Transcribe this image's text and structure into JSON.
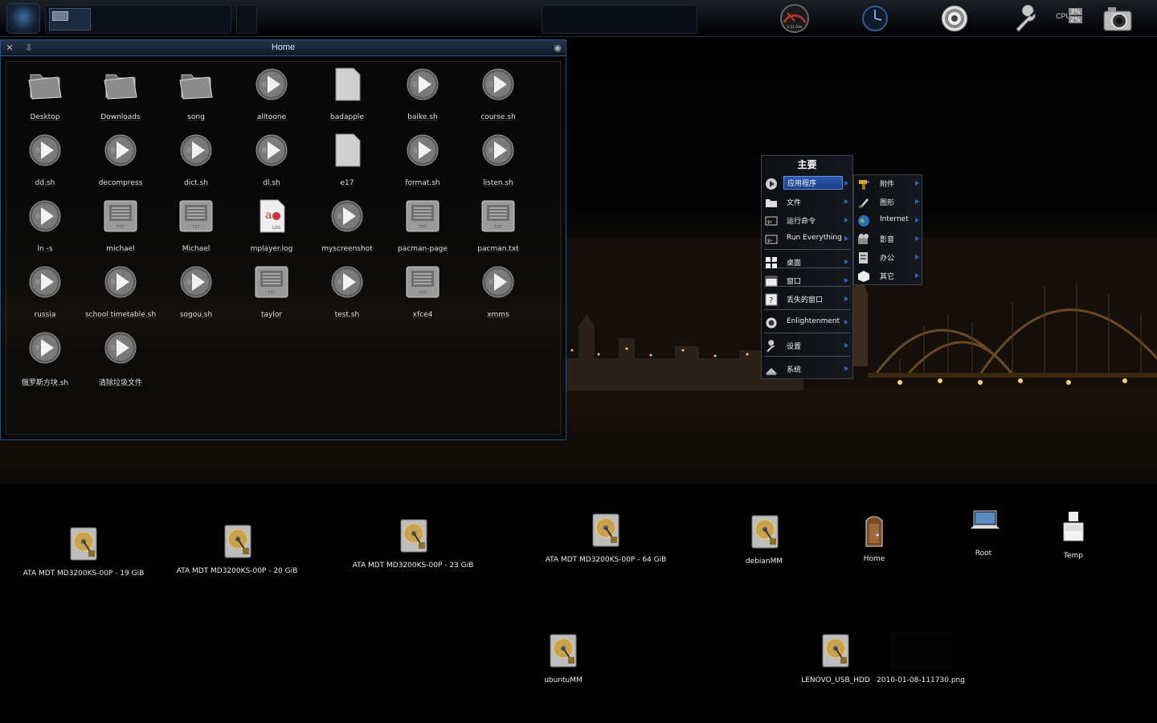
{
  "file_manager": {
    "title": "Home",
    "items": [
      {
        "label": "Desktop",
        "type": "folder"
      },
      {
        "label": "Downloads",
        "type": "folder"
      },
      {
        "label": "song",
        "type": "folder"
      },
      {
        "label": "alltoone",
        "type": "script"
      },
      {
        "label": "badapple",
        "type": "file"
      },
      {
        "label": "baike.sh",
        "type": "script"
      },
      {
        "label": "course.sh",
        "type": "script"
      },
      {
        "label": "dd.sh",
        "type": "script"
      },
      {
        "label": "decompress",
        "type": "script"
      },
      {
        "label": "dict.sh",
        "type": "script"
      },
      {
        "label": "dl.sh",
        "type": "script"
      },
      {
        "label": "e17",
        "type": "file"
      },
      {
        "label": "format.sh",
        "type": "script"
      },
      {
        "label": "listen.sh",
        "type": "script"
      },
      {
        "label": "ln -s",
        "type": "script"
      },
      {
        "label": "michael",
        "type": "text"
      },
      {
        "label": "Michael",
        "type": "text"
      },
      {
        "label": "mplayer.log",
        "type": "log"
      },
      {
        "label": "myscreenshot",
        "type": "script"
      },
      {
        "label": "pacman-page",
        "type": "text"
      },
      {
        "label": "pacman.txt",
        "type": "text"
      },
      {
        "label": "russia",
        "type": "script"
      },
      {
        "label": "school timetable.sh",
        "type": "script"
      },
      {
        "label": "sogou.sh",
        "type": "script"
      },
      {
        "label": "taylor",
        "type": "text"
      },
      {
        "label": "test.sh",
        "type": "script"
      },
      {
        "label": "xfce4",
        "type": "text"
      },
      {
        "label": "xmms",
        "type": "script"
      },
      {
        "label": "俄罗斯方块.sh",
        "type": "script"
      },
      {
        "label": "清除垃圾文件",
        "type": "script"
      }
    ]
  },
  "main_menu": {
    "title": "主要",
    "items": [
      {
        "label": "应用程序",
        "icon": "play-icon"
      },
      {
        "label": "文件",
        "icon": "folder-icon"
      },
      {
        "label": "运行命令",
        "icon": "terminal-icon"
      },
      {
        "label": "Run Everything",
        "icon": "terminal-icon"
      },
      {
        "label": "桌面",
        "icon": "desktop-grid-icon"
      },
      {
        "label": "窗口",
        "icon": "window-icon"
      },
      {
        "label": "丢失的窗口",
        "icon": "help-icon"
      },
      {
        "label": "Enlightenment",
        "icon": "enlightenment-icon"
      },
      {
        "label": "设置",
        "icon": "wrench-icon"
      },
      {
        "label": "系统",
        "icon": "system-icon"
      }
    ]
  },
  "sub_menu": {
    "items": [
      {
        "label": "附件",
        "icon": "drill-icon"
      },
      {
        "label": "图形",
        "icon": "brush-icon"
      },
      {
        "label": "Internet",
        "icon": "globe-icon"
      },
      {
        "label": "影音",
        "icon": "film-icon"
      },
      {
        "label": "办公",
        "icon": "office-icon"
      },
      {
        "label": "其它",
        "icon": "cube-icon"
      }
    ]
  },
  "shelf": {
    "cpu_label": "CPU",
    "cpu_values": [
      "3%",
      "2%"
    ],
    "cpufreq_label": "1.11 GHz"
  },
  "desktop_icons": [
    {
      "label": "ATA MDT MD3200KS-00P - 19 GiB",
      "icon": "hard-drive-icon"
    },
    {
      "label": "ATA MDT MD3200KS-00P - 20 GiB",
      "icon": "hard-drive-icon"
    },
    {
      "label": "ATA MDT MD3200KS-00P - 23 GiB",
      "icon": "hard-drive-icon"
    },
    {
      "label": "ATA MDT MD3200KS-00P - 64 GiB",
      "icon": "hard-drive-icon"
    },
    {
      "label": "debianMM",
      "icon": "hard-drive-icon"
    },
    {
      "label": "Home",
      "icon": "home-door-icon"
    },
    {
      "label": "Root",
      "icon": "laptop-icon"
    },
    {
      "label": "Temp",
      "icon": "temp-icon"
    },
    {
      "label": "ubuntuMM",
      "icon": "hard-drive-icon"
    },
    {
      "label": "LENOVO_USB_HDD",
      "icon": "hard-drive-icon"
    },
    {
      "label": "2010-01-08-111730.png",
      "icon": "image-thumbnail-icon"
    }
  ],
  "colors": {
    "accent": "#2b62d0",
    "window_border": "#1b4f86",
    "menu_selected": "#2c5ab0"
  }
}
